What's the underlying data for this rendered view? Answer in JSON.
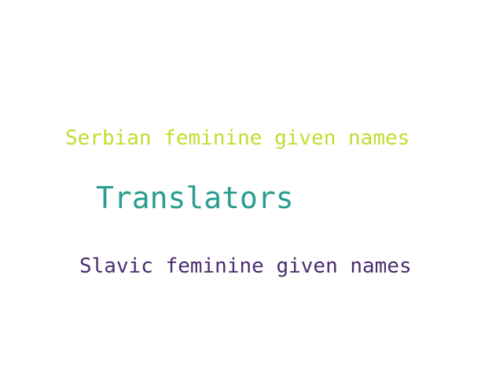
{
  "words": [
    {
      "text": "Serbian feminine given names",
      "color": "#c3dc2e"
    },
    {
      "text": "Translators",
      "color": "#2a9d8f"
    },
    {
      "text": "Slavic feminine given names",
      "color": "#4a2d6f"
    }
  ]
}
